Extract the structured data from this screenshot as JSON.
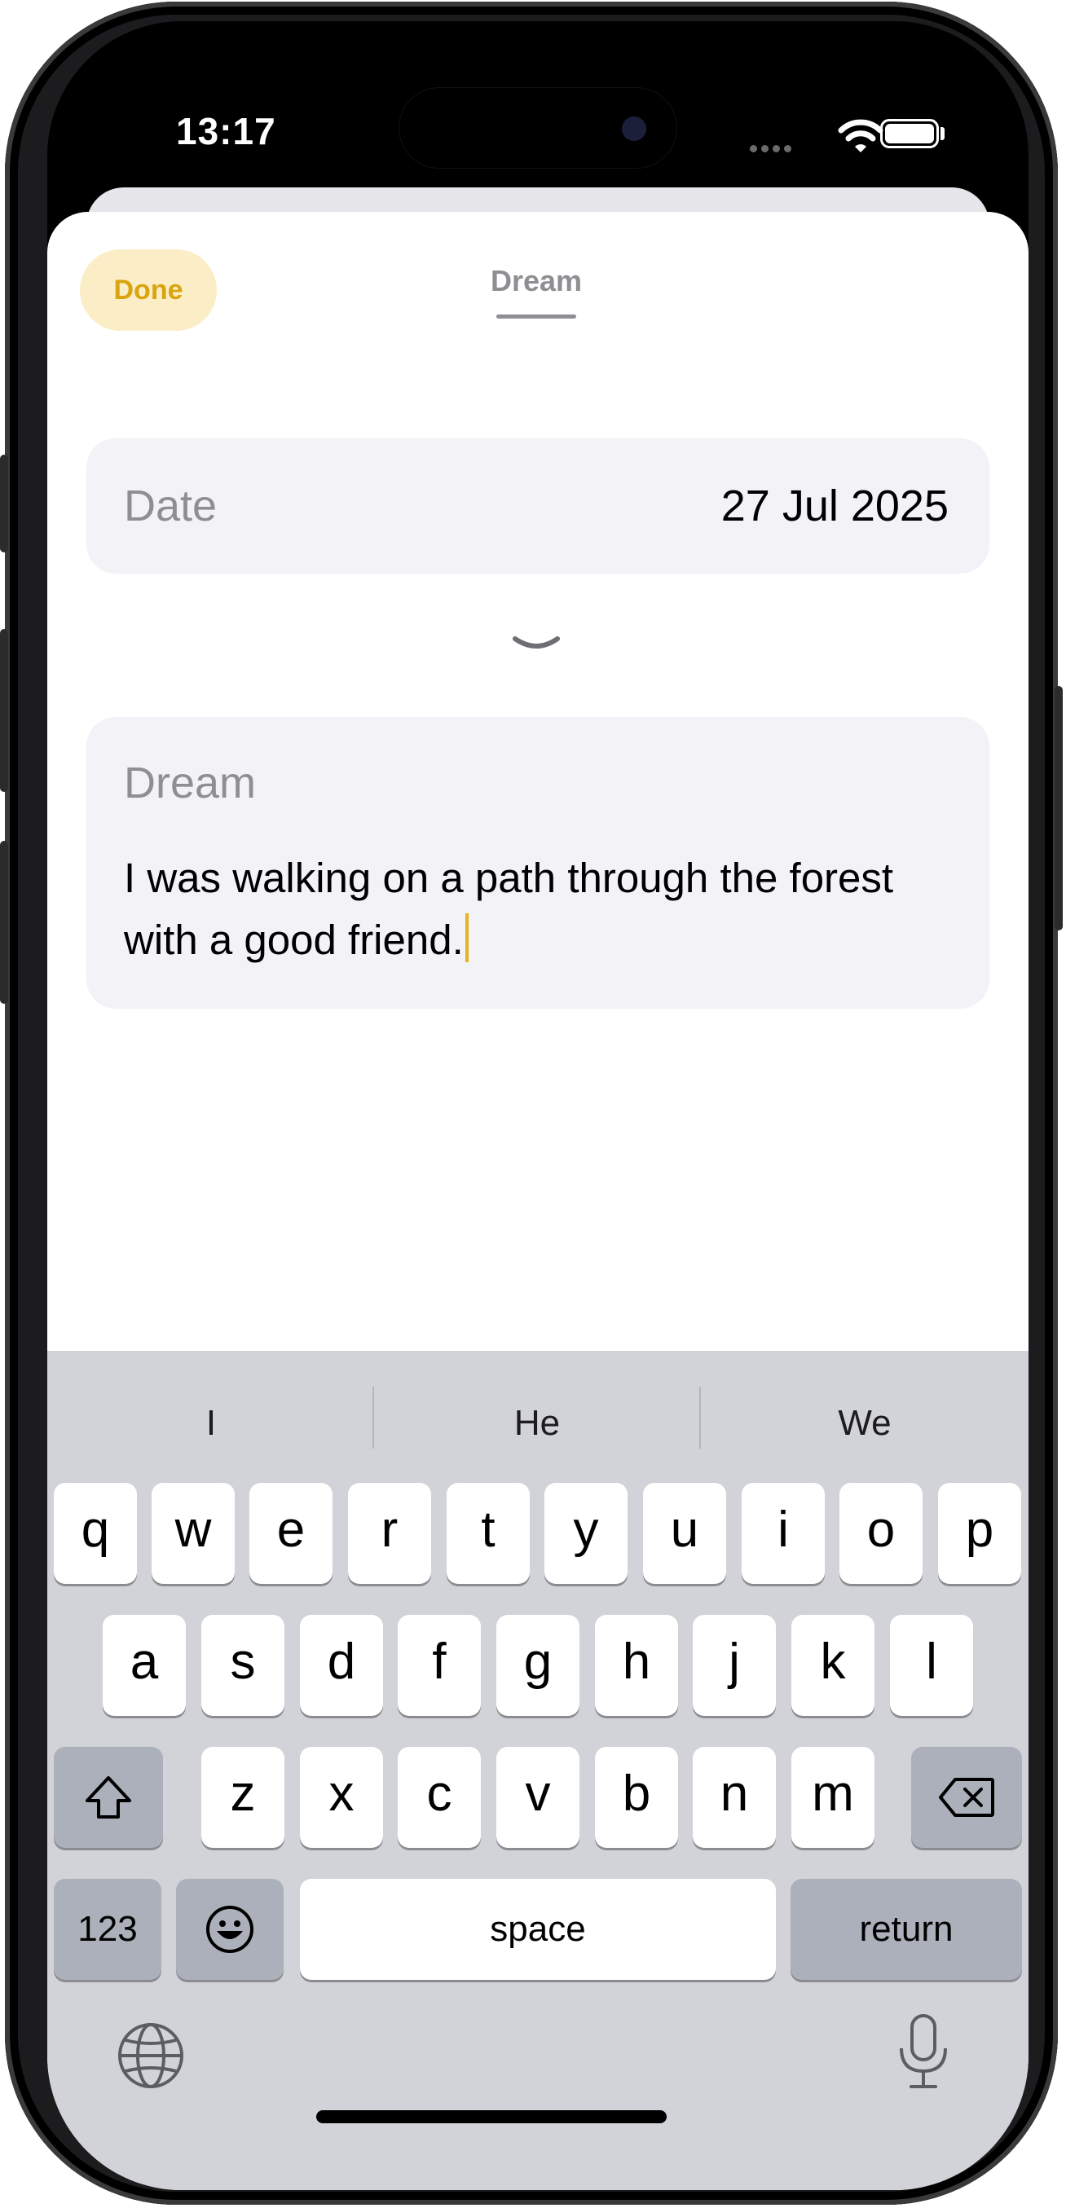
{
  "status_bar": {
    "time": "13:17"
  },
  "sheet": {
    "done_label": "Done",
    "tab_title": "Dream",
    "date_field": {
      "label": "Date",
      "value": "27 Jul 2025"
    },
    "dream_field": {
      "label": "Dream",
      "value": "I was walking on a path through the forest with a good friend."
    }
  },
  "keyboard": {
    "suggestions": [
      "I",
      "He",
      "We"
    ],
    "row1": [
      "q",
      "w",
      "e",
      "r",
      "t",
      "y",
      "u",
      "i",
      "o",
      "p"
    ],
    "row2": [
      "a",
      "s",
      "d",
      "f",
      "g",
      "h",
      "j",
      "k",
      "l"
    ],
    "row3": [
      "z",
      "x",
      "c",
      "v",
      "b",
      "n",
      "m"
    ],
    "numbers_label": "123",
    "space_label": "space",
    "return_label": "return",
    "icons": [
      "shift-icon",
      "backspace-icon",
      "emoji-icon",
      "globe-icon",
      "microphone-icon"
    ]
  },
  "colors": {
    "accent": "#d9a40f",
    "done_bg": "#fbedc6",
    "caret": "#e8b224",
    "card_bg": "#f2f2f7",
    "keyboard_bg": "#d1d3d9"
  }
}
